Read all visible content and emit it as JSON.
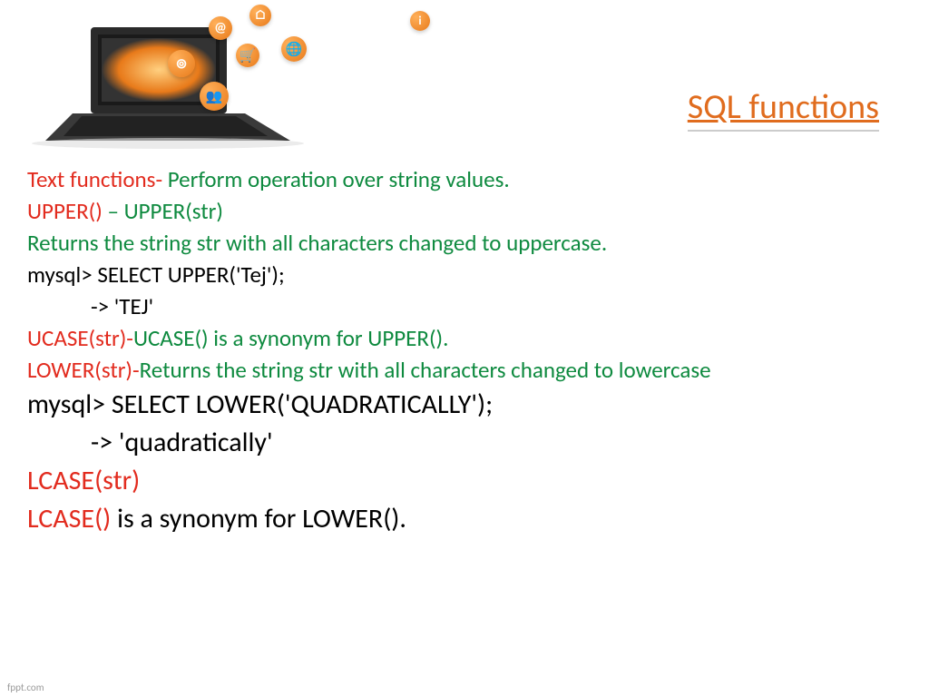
{
  "title": " SQL functions",
  "lines": {
    "l1a": "Text functions-",
    "l1b": " Perform operation over string values.",
    "l2a": "UPPER() ",
    "l2b": "– UPPER(str)",
    "l3": "Returns the string str with all characters changed to uppercase.",
    "l4": "mysql> SELECT UPPER('Tej');",
    "l5": "-> 'TEJ'",
    "l6a": "UCASE(str)-",
    "l6b": "UCASE() is a synonym for UPPER().",
    "l7a": "LOWER(str)-",
    "l7b": "Returns the string str with all characters changed to lowercase",
    "l8": "mysql> SELECT LOWER('QUADRATICALLY');",
    "l9": "-> 'quadratically'",
    "l10": "LCASE(str)",
    "l11a": "LCASE() ",
    "l11b": "is a synonym for LOWER()."
  },
  "footer": "fppt.com"
}
